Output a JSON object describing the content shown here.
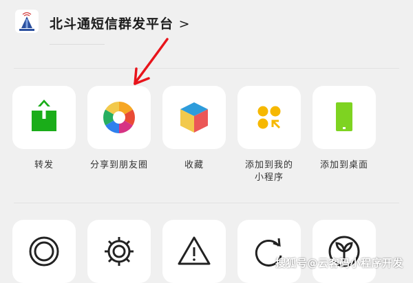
{
  "header": {
    "app_title": "北斗通短信群发平台",
    "chevron": ">"
  },
  "share_row": [
    {
      "id": "forward",
      "label": "转发",
      "icon": "share-upload-icon"
    },
    {
      "id": "moments",
      "label": "分享到朋友圈",
      "icon": "moments-aperture-icon"
    },
    {
      "id": "favorite",
      "label": "收藏",
      "icon": "favorite-cube-icon"
    },
    {
      "id": "my-mini-programs",
      "label": "添加到我的小程序",
      "icon": "mini-program-add-icon"
    },
    {
      "id": "desktop",
      "label": "添加到桌面",
      "icon": "desktop-phone-icon"
    }
  ],
  "action_row": [
    {
      "icon": "circle-ring-icon"
    },
    {
      "icon": "gear-icon"
    },
    {
      "icon": "warning-icon"
    },
    {
      "icon": "refresh-icon"
    },
    {
      "icon": "sprout-icon"
    }
  ],
  "watermark": "搜狐号@云客码小程序开发",
  "colors": {
    "background": "#f0f0f0",
    "tile": "#ffffff",
    "green": "#1aad19",
    "annotation_red": "#e8141b"
  }
}
